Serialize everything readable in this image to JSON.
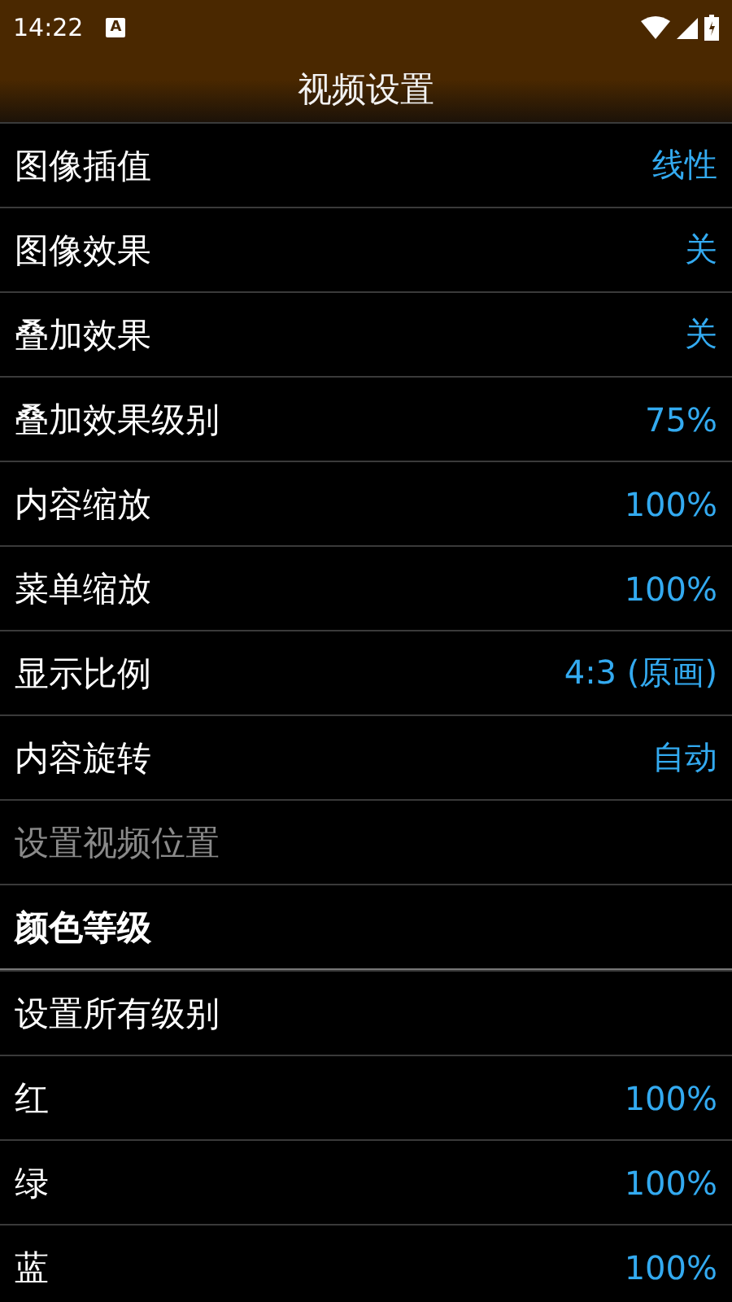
{
  "status_bar": {
    "time": "14:22",
    "notification": "A"
  },
  "title": "视频设置",
  "items": [
    {
      "kind": "setting",
      "label": "图像插值",
      "value": "线性",
      "disabled": false
    },
    {
      "kind": "setting",
      "label": "图像效果",
      "value": "关",
      "disabled": false
    },
    {
      "kind": "setting",
      "label": "叠加效果",
      "value": "关",
      "disabled": false
    },
    {
      "kind": "setting",
      "label": "叠加效果级别",
      "value": "75%",
      "disabled": false
    },
    {
      "kind": "setting",
      "label": "内容缩放",
      "value": "100%",
      "disabled": false
    },
    {
      "kind": "setting",
      "label": "菜单缩放",
      "value": "100%",
      "disabled": false
    },
    {
      "kind": "setting",
      "label": "显示比例",
      "value": "4:3 (原画)",
      "disabled": false
    },
    {
      "kind": "setting",
      "label": "内容旋转",
      "value": "自动",
      "disabled": false
    },
    {
      "kind": "setting",
      "label": "设置视频位置",
      "disabled": true
    },
    {
      "kind": "header",
      "label": "颜色等级"
    },
    {
      "kind": "setting",
      "label": "设置所有级别",
      "disabled": false
    },
    {
      "kind": "setting",
      "label": "红",
      "value": "100%",
      "disabled": false
    },
    {
      "kind": "setting",
      "label": "绿",
      "value": "100%",
      "disabled": false
    },
    {
      "kind": "setting",
      "label": "蓝",
      "value": "100%",
      "disabled": false
    }
  ]
}
